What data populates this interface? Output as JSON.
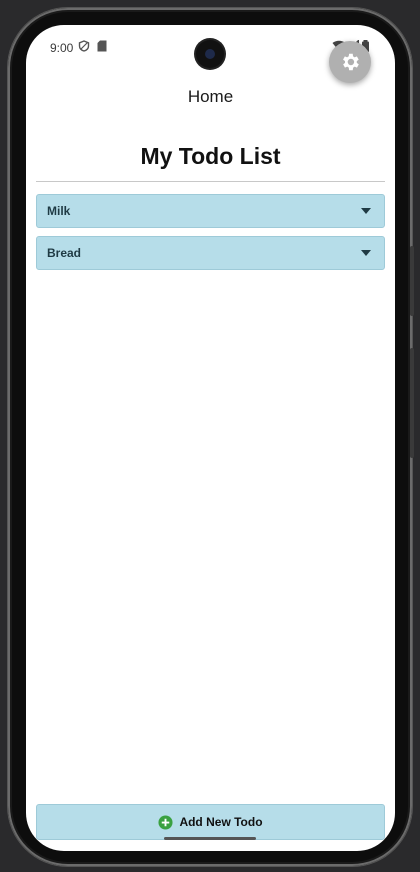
{
  "status_bar": {
    "time": "9:00",
    "left_icons": [
      "shield-icon",
      "sd-card-icon"
    ],
    "right_icons": [
      "wifi-icon",
      "signal-icon",
      "battery-icon"
    ]
  },
  "app_bar": {
    "title": "Home"
  },
  "page": {
    "title": "My Todo List"
  },
  "todos": [
    {
      "label": "Milk"
    },
    {
      "label": "Bread"
    }
  ],
  "add_button": {
    "label": "Add New Todo",
    "icon": "plus-circle-icon"
  },
  "colors": {
    "item_bg": "#b6dde9",
    "accent_green": "#3aa141",
    "fab_bg": "#b0b0b0"
  }
}
